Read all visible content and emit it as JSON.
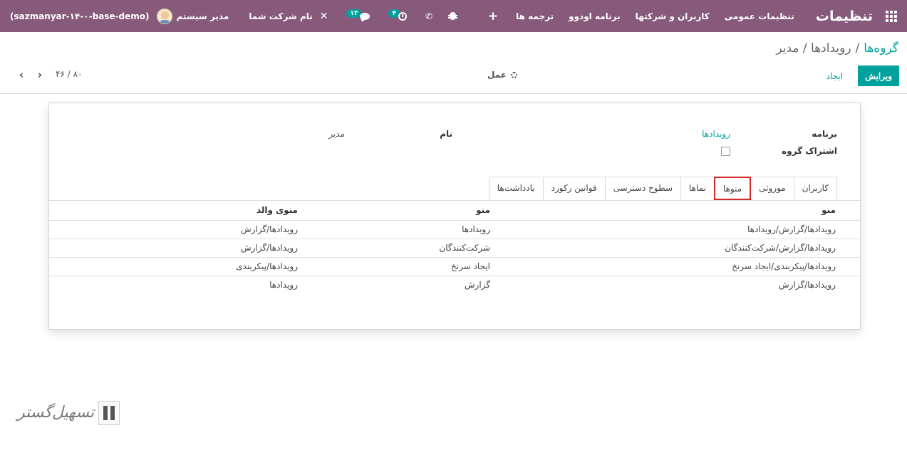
{
  "navbar": {
    "app_title": "تنظیمات",
    "menu": [
      "تنظیمات عمومی",
      "کاربران و شرکتها",
      "برنامه اودوو",
      "ترجمه ها"
    ],
    "plus_icon": "+",
    "systray": {
      "db_name": "(sazmanyar-۱۴-۰-base-demo)",
      "user_name": "مدیر سیستم",
      "company_name": "نام شرکت شما",
      "messages_count": "۱۳",
      "activities_count": "۴",
      "icons": [
        "apps-icon",
        "close-x-icon",
        "chat-icon",
        "clock-icon",
        "phone-icon",
        "bug-icon"
      ]
    },
    "bg_color": "#875a7b"
  },
  "breadcrumb": {
    "root": "گروه‌ها",
    "separator": "/",
    "current": "رویدادها / مدیر"
  },
  "control_panel": {
    "edit_label": "ویرایش",
    "create_label": "ایجاد",
    "action_label": "عمل",
    "pager_value": "۴۶ / ۸۰",
    "prev_label": "‹",
    "next_label": "›"
  },
  "form": {
    "application_label": "برنامه",
    "application_value": "رویدادها",
    "name_label": "نام",
    "name_value": "مدیر",
    "share_label": "اشتراک گروه",
    "share_checked": false
  },
  "tabs": [
    {
      "label": "کاربران",
      "active": false
    },
    {
      "label": "موروثی",
      "active": false
    },
    {
      "label": "منوها",
      "active": true
    },
    {
      "label": "نماها",
      "active": false
    },
    {
      "label": "سطوح دسترسی",
      "active": false
    },
    {
      "label": "قوانین رکورد",
      "active": false
    },
    {
      "label": "یادداشت‌ها",
      "active": false
    }
  ],
  "menus_table": {
    "headers": [
      "منو",
      "منو",
      "منوی والد"
    ],
    "rows": [
      [
        "رویدادها/گزارش/رویدادها",
        "رویدادها",
        "رویدادها/گزارش"
      ],
      [
        "رویدادها/گزارش/شرکت‌کنندگان",
        "شرکت‌کنندگان",
        "رویدادها/گزارش"
      ],
      [
        "رویدادها/پیکربندی/ایجاد سرنخ",
        "ایجاد سرنخ",
        "رویدادها/پیکربندی"
      ],
      [
        "رویدادها/گزارش",
        "گزارش",
        "رویدادها"
      ]
    ]
  },
  "watermark": {
    "text": "تسهیل‌گستر"
  },
  "colors": {
    "primary": "#00a09d",
    "active_tab_outline": "#d62828"
  }
}
